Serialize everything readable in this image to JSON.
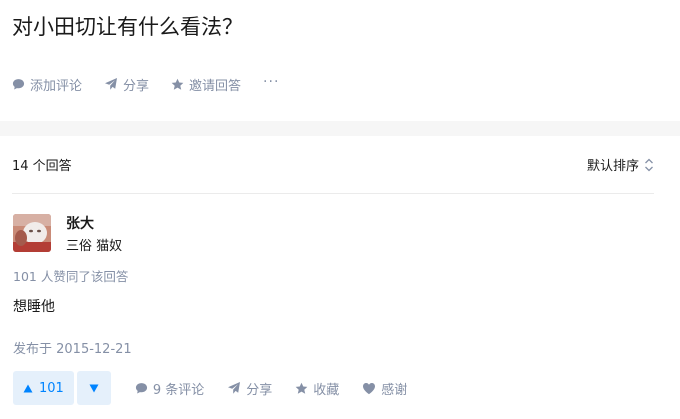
{
  "question": {
    "title": "对小田切让有什么看法？",
    "actions": {
      "add_comment": "添加评论",
      "share": "分享",
      "invite": "邀请回答",
      "more": "···"
    }
  },
  "answers": {
    "count_label": "14 个回答",
    "sort_label": "默认排序",
    "items": [
      {
        "author_name": "张大",
        "author_bio": "三俗 猫奴",
        "vote_info": "101 人赞同了该回答",
        "content": "想睡他",
        "date": "发布于 2015-12-21",
        "upvotes": "101",
        "actions": {
          "comments": "9 条评论",
          "share": "分享",
          "collect": "收藏",
          "thanks": "感谢"
        }
      }
    ]
  },
  "colors": {
    "accent": "#0084ff",
    "muted": "#8590a6",
    "vote_bg": "#e5f0fb",
    "page_bg": "#f6f6f6"
  },
  "icons": [
    "comment-icon",
    "share-icon",
    "star-icon",
    "more-icon",
    "sort-icon",
    "upvote-icon",
    "downvote-icon",
    "heart-icon"
  ]
}
